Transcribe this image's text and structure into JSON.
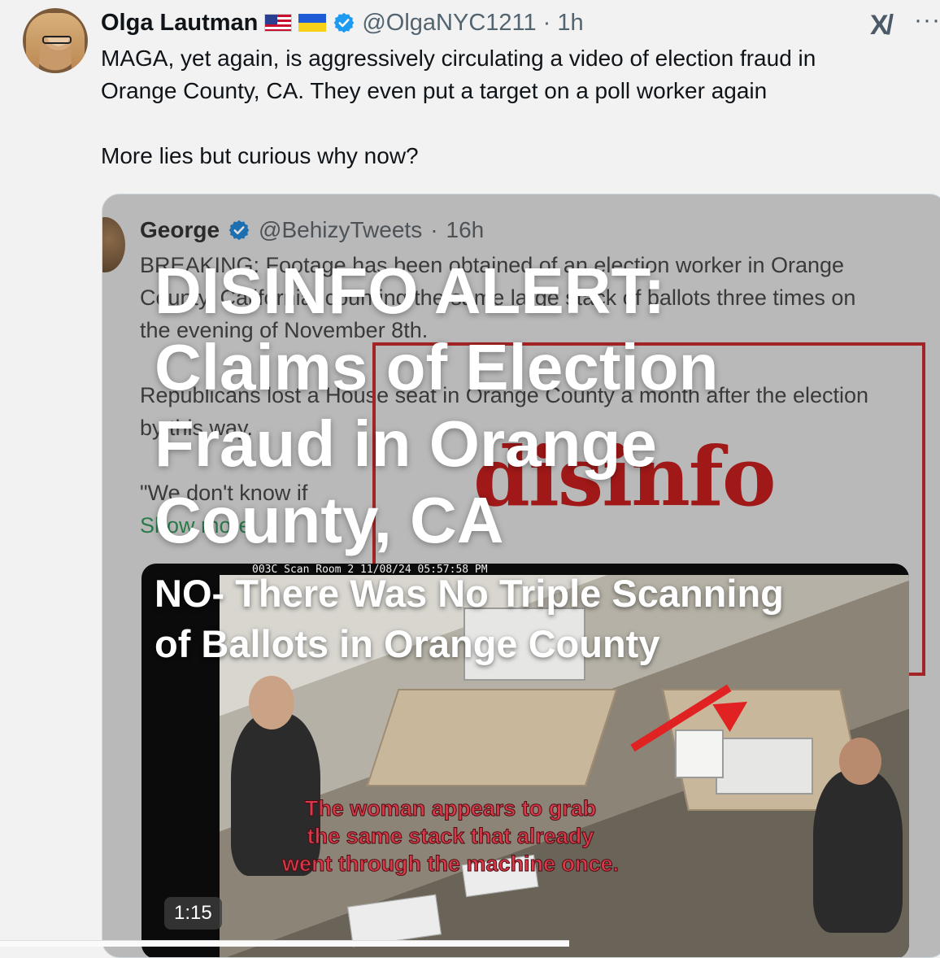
{
  "post": {
    "author_name": "Olga Lautman",
    "handle": "@OlgaNYC1211",
    "separator": "·",
    "age": "1h",
    "icons": {
      "flag1": "us-flag-icon",
      "flag2": "ukraine-flag-icon",
      "verified": "verified-badge-icon",
      "logo": "x-logo-icon",
      "more": "more-options-icon"
    },
    "logo_text": "X/",
    "more_label": "···",
    "text_lines": [
      "MAGA, yet again, is aggressively circulating a video of election fraud in",
      "Orange County, CA. They even put a target on a poll worker again",
      "More lies but curious why now?"
    ]
  },
  "media": {
    "quoted": {
      "name": "George",
      "handle": "@BehizyTweets",
      "separator": "·",
      "age": "16h",
      "lines": [
        "BREAKING: Footage has been obtained of an election worker in Orange",
        "County, California, counting the same large stack of ballots three times on",
        "the evening of November 8th.",
        "Republicans lost a House seat in Orange County a month after the election",
        "by this way.",
        "\"We don't know if",
        "Show more"
      ]
    },
    "stamp_word": "disinfo",
    "overlay_title_lines": [
      "DISINFO ALERT:",
      "Claims of Election",
      "Fraud in Orange",
      "County, CA"
    ],
    "overlay_sub_lines": [
      "NO- There Was No Triple Scanning",
      "of Ballots in Orange County"
    ],
    "video": {
      "camera_stamp": "003C Scan Room 2 11/08/24 05:57:58 PM",
      "caption_lines": [
        "The woman appears to grab",
        "the same stack that already",
        "went through the machine once."
      ],
      "duration": "1:15"
    }
  },
  "colors": {
    "verified_blue": "#1d9bf0",
    "stamp_red": "#a01818",
    "caption_red": "#d83a4a"
  }
}
